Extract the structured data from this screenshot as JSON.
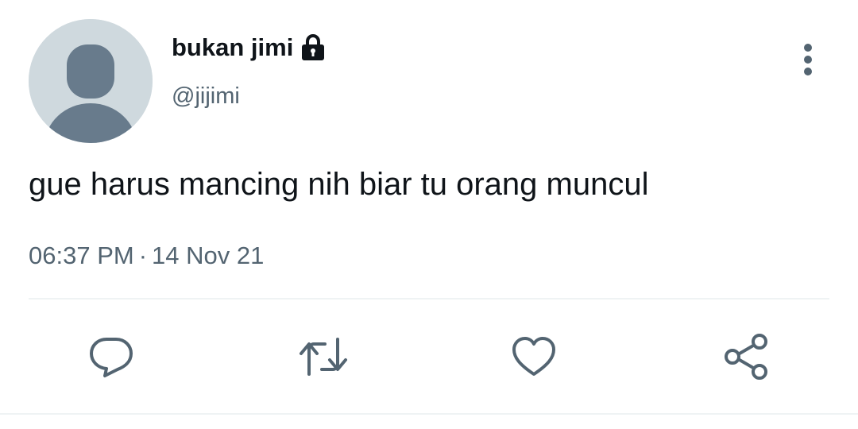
{
  "user": {
    "display_name": "bukan jimi",
    "handle": "@jijimi",
    "protected_icon": "lock-icon",
    "avatar_icon": "default-avatar-icon"
  },
  "tweet": {
    "text": "gue harus mancing nih biar tu orang muncul",
    "time": "06:37 PM",
    "separator": "·",
    "date": "14 Nov 21"
  },
  "actions": {
    "reply_icon": "reply-icon",
    "retweet_icon": "retweet-icon",
    "like_icon": "heart-icon",
    "share_icon": "share-icon",
    "more_icon": "more-vertical-icon"
  },
  "colors": {
    "primary_text": "#0f1419",
    "secondary_text": "#536471",
    "avatar_bg": "#cfd9de",
    "avatar_fg": "#687b8c",
    "divider": "#eff3f4"
  }
}
